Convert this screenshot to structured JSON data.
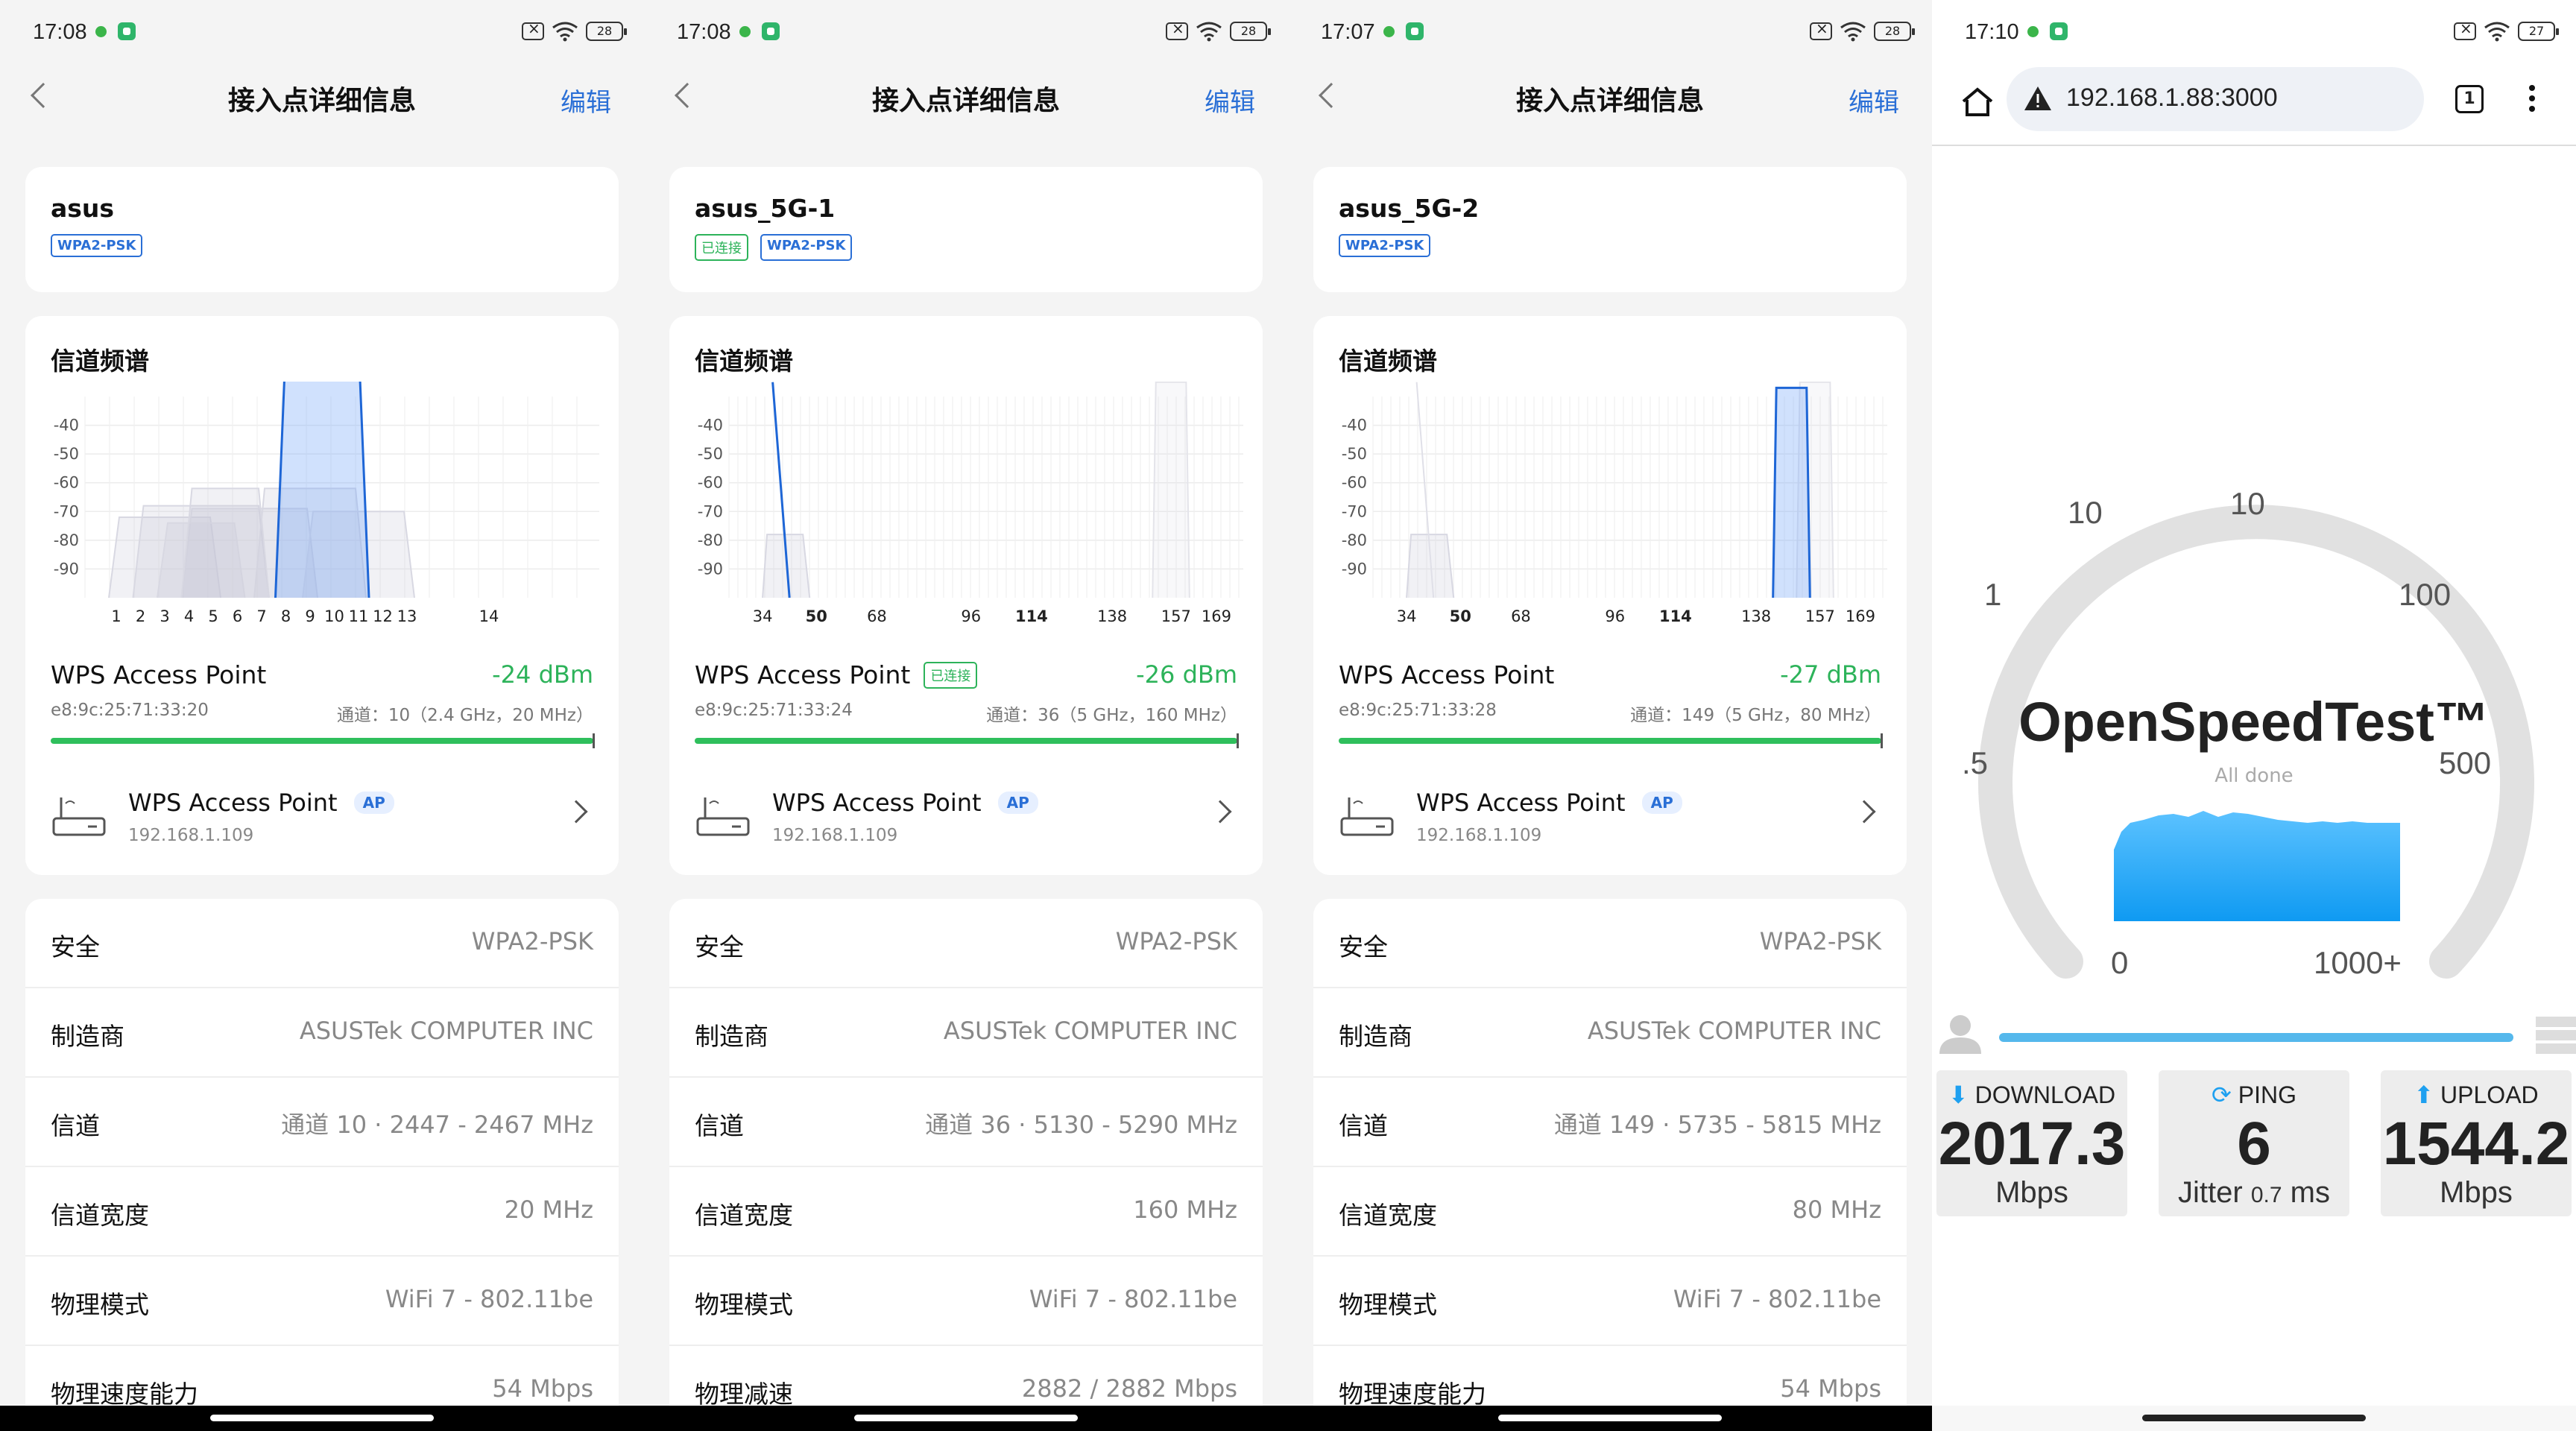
{
  "phones": [
    {
      "time": "17:08",
      "battery": "28",
      "title": "接入点详细信息",
      "edit": "编辑",
      "ssid": "asus",
      "tags": [
        "WPA2-PSK"
      ],
      "tag_connected": false,
      "section": "信道频谱",
      "ap_name": "WPS Access Point",
      "ap_connected": false,
      "dbm": "-24 dBm",
      "mac": "e8:9c:25:71:33:20",
      "channel_info": "通道：10（2.4 GHz，20 MHz）",
      "ap_row_name": "WPS Access Point",
      "ap_badge": "AP",
      "ip": "192.168.1.109",
      "rows": [
        {
          "k": "安全",
          "v": "WPA2-PSK"
        },
        {
          "k": "制造商",
          "v": "ASUSTek COMPUTER INC"
        },
        {
          "k": "信道",
          "v": "通道 10 · 2447 - 2467 MHz"
        },
        {
          "k": "信道宽度",
          "v": "20 MHz"
        },
        {
          "k": "物理模式",
          "v": "WiFi 7 - 802.11be"
        },
        {
          "k": "物理速度能力",
          "v": "54 Mbps"
        }
      ],
      "chart_data": {
        "type": "area",
        "band": "2.4 GHz",
        "ylabel_ticks": [
          -40,
          -50,
          -60,
          -70,
          -80,
          -90
        ],
        "xticks": [
          "1",
          "2",
          "3",
          "4",
          "5",
          "6",
          "7",
          "8",
          "9",
          "10",
          "11",
          "12",
          "13",
          "14"
        ],
        "highlight": {
          "channel": 10,
          "width_channels": 4,
          "dbm": -24
        }
      }
    },
    {
      "time": "17:08",
      "battery": "28",
      "title": "接入点详细信息",
      "edit": "编辑",
      "ssid": "asus_5G-1",
      "tags": [
        "WPA2-PSK"
      ],
      "tag_connected_label": "已连接",
      "tag_connected": true,
      "section": "信道频谱",
      "ap_name": "WPS Access Point",
      "ap_connected": true,
      "ap_connected_label": "已连接",
      "dbm": "-26 dBm",
      "mac": "e8:9c:25:71:33:24",
      "channel_info": "通道：36（5 GHz，160 MHz）",
      "ap_row_name": "WPS Access Point",
      "ap_badge": "AP",
      "ip": "192.168.1.109",
      "rows": [
        {
          "k": "安全",
          "v": "WPA2-PSK"
        },
        {
          "k": "制造商",
          "v": "ASUSTek COMPUTER INC"
        },
        {
          "k": "信道",
          "v": "通道 36 · 5130 - 5290 MHz"
        },
        {
          "k": "信道宽度",
          "v": "160 MHz"
        },
        {
          "k": "物理模式",
          "v": "WiFi 7 - 802.11be"
        },
        {
          "k": "物理减速",
          "v": "2882 / 2882 Mbps"
        }
      ],
      "chart_data": {
        "type": "area",
        "band": "5 GHz",
        "ylabel_ticks": [
          -40,
          -50,
          -60,
          -70,
          -80,
          -90
        ],
        "xticks": [
          "34",
          "50",
          "68",
          "96",
          "114",
          "138",
          "157",
          "169"
        ],
        "highlight": {
          "channel": 36,
          "width_mhz": 160,
          "dbm": -26
        }
      }
    },
    {
      "time": "17:07",
      "battery": "28",
      "title": "接入点详细信息",
      "edit": "编辑",
      "ssid": "asus_5G-2",
      "tags": [
        "WPA2-PSK"
      ],
      "tag_connected": false,
      "section": "信道频谱",
      "ap_name": "WPS Access Point",
      "ap_connected": false,
      "dbm": "-27 dBm",
      "mac": "e8:9c:25:71:33:28",
      "channel_info": "通道：149（5 GHz，80 MHz）",
      "ap_row_name": "WPS Access Point",
      "ap_badge": "AP",
      "ip": "192.168.1.109",
      "rows": [
        {
          "k": "安全",
          "v": "WPA2-PSK"
        },
        {
          "k": "制造商",
          "v": "ASUSTek COMPUTER INC"
        },
        {
          "k": "信道",
          "v": "通道 149 · 5735 - 5815 MHz"
        },
        {
          "k": "信道宽度",
          "v": "80 MHz"
        },
        {
          "k": "物理模式",
          "v": "WiFi 7 - 802.11be"
        },
        {
          "k": "物理速度能力",
          "v": "54 Mbps"
        }
      ],
      "chart_data": {
        "type": "area",
        "band": "5 GHz",
        "ylabel_ticks": [
          -40,
          -50,
          -60,
          -70,
          -80,
          -90
        ],
        "xticks": [
          "34",
          "50",
          "68",
          "96",
          "114",
          "138",
          "157",
          "169"
        ],
        "highlight": {
          "channel": 149,
          "width_mhz": 80,
          "dbm": -27
        }
      }
    }
  ],
  "browser": {
    "time": "17:10",
    "battery": "27",
    "url": "192.168.1.88:3000",
    "tab_count": "1",
    "app_name": "OpenSpeedTest™",
    "status": "All done",
    "gauge_labels": [
      ".5",
      "1",
      "10",
      "100",
      "500",
      "0",
      "1000+"
    ],
    "download": {
      "label": "DOWNLOAD",
      "value": "2017.3",
      "unit": "Mbps"
    },
    "ping": {
      "label": "PING",
      "value": "6",
      "jitter_label": "Jitter",
      "jitter": "0.7",
      "unit": "ms"
    },
    "upload": {
      "label": "UPLOAD",
      "value": "1544.2",
      "unit": "Mbps"
    }
  },
  "colors": {
    "accent": "#2a6fd6",
    "green": "#2db35a",
    "speed_blue": "#1ea0f0"
  }
}
